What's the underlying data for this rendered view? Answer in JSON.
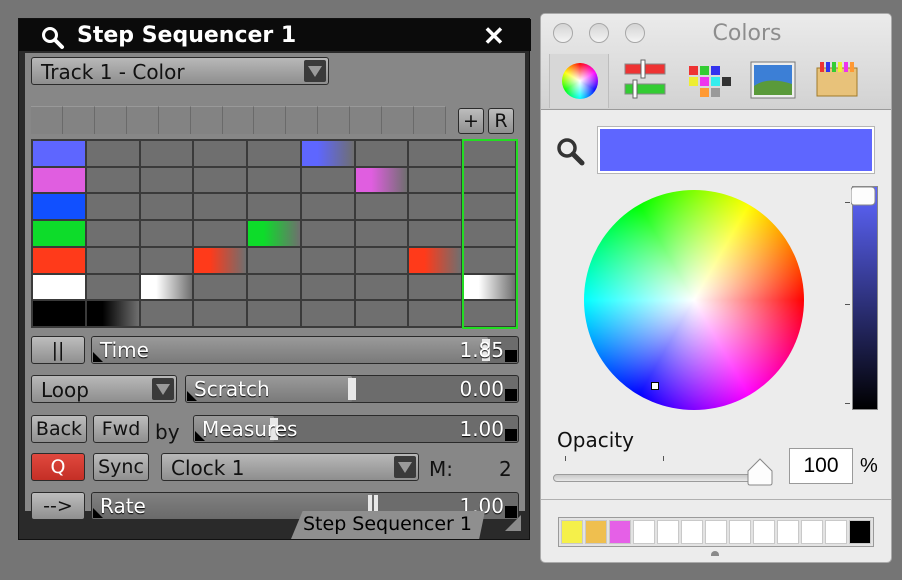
{
  "sequencer": {
    "title": "Step Sequencer 1",
    "track_select": "Track 1 - Color",
    "add_label": "+",
    "reset_label": "R",
    "pause_label": "||",
    "time": {
      "label": "Time",
      "value": "1.85"
    },
    "loop_select": "Loop",
    "scratch": {
      "label": "Scratch",
      "value": "0.00"
    },
    "back_label": "Back",
    "fwd_label": "Fwd",
    "by_label": "by",
    "measures": {
      "label": "Measures",
      "value": "1.00"
    },
    "q_label": "Q",
    "sync_label": "Sync",
    "clock_select": "Clock 1",
    "m_label": "M:",
    "m_value": "2",
    "arrow_label": "-->",
    "rate": {
      "label": "Rate",
      "value": "1.00"
    },
    "tab_label": "Step Sequencer 1",
    "grid": {
      "columns": 9,
      "rows": [
        {
          "color": "#5e66ff",
          "steps": [
            {
              "col": 0,
              "len": 1
            },
            {
              "col": 5,
              "len": 1
            }
          ]
        },
        {
          "color": "#e05ee0",
          "steps": [
            {
              "col": 0,
              "len": 1
            },
            {
              "col": 6,
              "len": 1
            }
          ]
        },
        {
          "color": "#1150ff",
          "steps": [
            {
              "col": 0,
              "len": 1
            }
          ]
        },
        {
          "color": "#0ddc2a",
          "steps": [
            {
              "col": 0,
              "len": 1
            },
            {
              "col": 4,
              "len": 1
            }
          ]
        },
        {
          "color": "#ff3a1a",
          "steps": [
            {
              "col": 0,
              "len": 1
            },
            {
              "col": 3,
              "len": 1
            },
            {
              "col": 7,
              "len": 1
            }
          ]
        },
        {
          "color": "#ffffff",
          "steps": [
            {
              "col": 0,
              "len": 1
            },
            {
              "col": 2,
              "len": 1
            },
            {
              "col": 8,
              "len": 1
            }
          ]
        },
        {
          "color": "#000000",
          "steps": [
            {
              "col": 0,
              "len": 1
            },
            {
              "col": 1,
              "len": 1
            }
          ]
        }
      ]
    }
  },
  "colors": {
    "title": "Colors",
    "selected_color": "#5e66ff",
    "opacity_label": "Opacity",
    "opacity_value": "100",
    "opacity_unit": "%",
    "palette_colors": [
      "#f5f04a",
      "#efbf4f",
      "#e560e7",
      "#ffffff",
      "#ffffff",
      "#ffffff",
      "#ffffff",
      "#ffffff",
      "#ffffff",
      "#ffffff",
      "#ffffff",
      "#ffffff",
      "#000000"
    ],
    "toolbar_icons": [
      "color-wheel-icon",
      "sliders-icon",
      "palettes-icon",
      "image-icon",
      "crayons-icon"
    ]
  }
}
